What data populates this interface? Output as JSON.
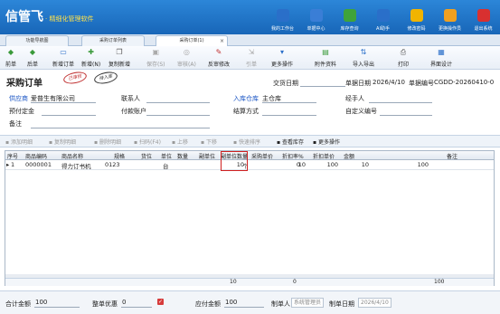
{
  "app": {
    "name": "信管飞",
    "subtitle": "· 精细化管理软件"
  },
  "topnav": [
    {
      "label": "我的工作台",
      "icon": "monitor-icon",
      "color": "#2a6fc9"
    },
    {
      "label": "单据中心",
      "icon": "documents-icon",
      "color": "#3a7ed6"
    },
    {
      "label": "库存查询",
      "icon": "inventory-icon",
      "color": "#3fa33a"
    },
    {
      "label": "AI助手",
      "icon": "info-icon",
      "color": "#2a6fc9"
    },
    {
      "label": "修改密码",
      "icon": "lock-icon",
      "color": "#f0b400"
    },
    {
      "label": "更换操作员",
      "icon": "user-switch-icon",
      "color": "#f0a020"
    },
    {
      "label": "退出系统",
      "icon": "exit-icon",
      "color": "#d83030"
    }
  ],
  "tabs": [
    {
      "label": "功能导航图"
    },
    {
      "label": "采购订单列表"
    },
    {
      "label": "采购订单(1)"
    }
  ],
  "toolbar": [
    {
      "label": "前单",
      "icon": "arrow-left-icon",
      "glyph": "◆",
      "enabled": true,
      "color": "#3a9a3a"
    },
    {
      "label": "后单",
      "icon": "arrow-right-icon",
      "glyph": "◆",
      "enabled": true,
      "color": "#3a9a3a"
    },
    {
      "label": "新增订单",
      "icon": "new-doc-icon",
      "glyph": "▭",
      "enabled": true,
      "color": "#2a6fc9"
    },
    {
      "label": "新增(N)",
      "icon": "add-icon",
      "glyph": "✚",
      "enabled": true,
      "color": "#3a9a3a"
    },
    {
      "label": "复制新增",
      "icon": "copy-icon",
      "glyph": "❐",
      "enabled": true,
      "color": "#555"
    },
    {
      "label": "保存(S)",
      "icon": "save-icon",
      "glyph": "▣",
      "enabled": false,
      "color": "#aaa"
    },
    {
      "label": "审核(A)",
      "icon": "audit-icon",
      "glyph": "◎",
      "enabled": false,
      "color": "#aaa"
    },
    {
      "label": "反审修改",
      "icon": "unaudit-icon",
      "glyph": "✎",
      "enabled": true,
      "color": "#c03030"
    },
    {
      "label": "引单",
      "icon": "import-order-icon",
      "glyph": "⇲",
      "enabled": false,
      "color": "#aaa"
    },
    {
      "label": "更多操作",
      "icon": "more-ops-icon",
      "glyph": "▾",
      "enabled": true,
      "color": "#2a6fc9"
    },
    {
      "label": "附件资料",
      "icon": "attachment-icon",
      "glyph": "▤",
      "enabled": true,
      "color": "#3a9a3a"
    },
    {
      "label": "导入导出",
      "icon": "import-export-icon",
      "glyph": "⇅",
      "enabled": true,
      "color": "#2a6fc9"
    },
    {
      "label": "打印",
      "icon": "print-icon",
      "glyph": "⎙",
      "enabled": true,
      "color": "#555"
    },
    {
      "label": "界面设计",
      "icon": "layout-design-icon",
      "glyph": "▦",
      "enabled": true,
      "color": "#2a6fc9"
    }
  ],
  "form": {
    "title": "采购订单",
    "stamp_approved": "已审核",
    "stamp_warehoused": "待入库",
    "trade_date_label": "交货日期",
    "doc_date_label": "单据日期",
    "doc_date": "2026/4/10",
    "doc_no_label": "单据编号",
    "doc_no": "CGDD-20260410-0",
    "supplier_label": "供应商",
    "supplier": "爱普生有限公司",
    "contact_label": "联系人",
    "warehouse_label": "入库仓库",
    "warehouse": "主仓库",
    "handler_label": "经手人",
    "deposit_label": "预付定金",
    "account_label": "付款账户",
    "settle_label": "结算方式",
    "custom_no_label": "自定义编号",
    "remark_label": "备注"
  },
  "gridbar": [
    {
      "label": "添加明细",
      "icon": "add-row-icon",
      "enabled": false
    },
    {
      "label": "复制明细",
      "icon": "copy-row-icon",
      "enabled": false
    },
    {
      "label": "删除明细",
      "icon": "delete-row-icon",
      "enabled": false
    },
    {
      "label": "扫码(F4)",
      "icon": "scan-icon",
      "enabled": false
    },
    {
      "label": "上移",
      "icon": "move-up-icon",
      "enabled": false
    },
    {
      "label": "下移",
      "icon": "move-down-icon",
      "enabled": false
    },
    {
      "label": "快速排序",
      "icon": "sort-icon",
      "enabled": false
    },
    {
      "label": "查看库存",
      "icon": "view-stock-icon",
      "enabled": true
    },
    {
      "label": "更多操作",
      "icon": "more-ops-icon",
      "enabled": true
    }
  ],
  "grid": {
    "headers": [
      "序号",
      "商品编码",
      "商品名称",
      "规格",
      "货位",
      "单位",
      "数量",
      "副单位",
      "副单位数量",
      "采购单价",
      "折扣率%",
      "折扣单价",
      "金额",
      "备注"
    ],
    "rows": [
      {
        "seq": "1",
        "code": "0000001",
        "name": "得力订书机",
        "spec": "0123",
        "loc": "",
        "unit": "台",
        "qty": "10",
        "sub_unit": "个",
        "sub_qty": "0",
        "price": "10",
        "discount": "100",
        "disc_price": "10",
        "amount": "100",
        "remark": ""
      }
    ],
    "totals": {
      "qty": "10",
      "sub_qty": "0",
      "amount": "100"
    }
  },
  "footer": {
    "total_label": "合计金额",
    "total": "100",
    "discount_label": "整单优惠",
    "discount": "0",
    "payable_label": "应付金额",
    "payable": "100",
    "maker_label": "制单人",
    "maker": "系统管理员",
    "make_date_label": "制单日期",
    "make_date": "2026/4/10"
  }
}
